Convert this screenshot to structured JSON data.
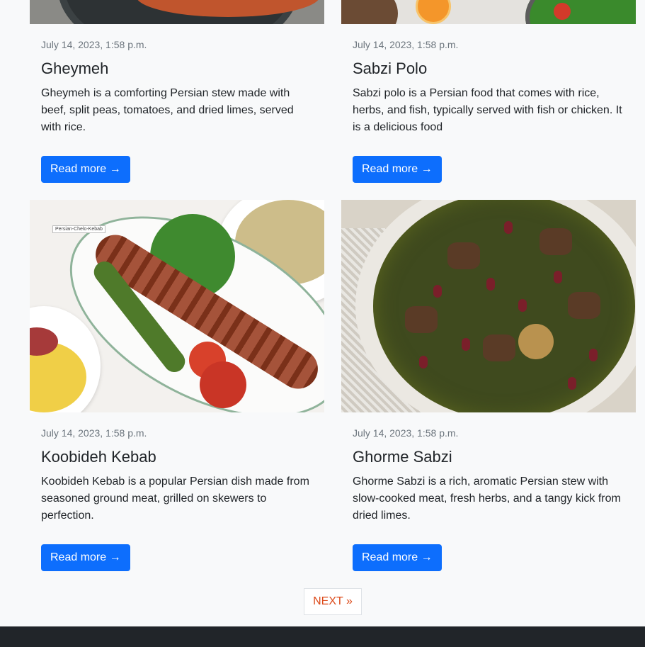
{
  "posts": [
    {
      "date": "July 14, 2023, 1:58 p.m.",
      "title": "Gheymeh",
      "description": "Gheymeh is a comforting Persian stew made with beef, split peas, tomatoes, and dried limes, served with rice.",
      "button": "Read more →"
    },
    {
      "date": "July 14, 2023, 1:58 p.m.",
      "title": "Sabzi Polo",
      "description": "Sabzi polo is a Persian food that comes with rice, herbs, and fish, typically served with fish or chicken. It is a delicious food",
      "button": "Read more →"
    },
    {
      "date": "July 14, 2023, 1:58 p.m.",
      "title": "Koobideh Kebab",
      "description": "Koobideh Kebab is a popular Persian dish made from seasoned ground meat, grilled on skewers to perfection.",
      "button": "Read more →",
      "image_caption": "Persian-Chelo-Kebab"
    },
    {
      "date": "July 14, 2023, 1:58 p.m.",
      "title": "Ghorme Sabzi",
      "description": "Ghorme Sabzi is a rich, aromatic Persian stew with slow-cooked meat, fresh herbs, and a tangy kick from dried limes.",
      "button": "Read more →"
    }
  ],
  "pagination": {
    "next_label": "NEXT »"
  },
  "colors": {
    "primary_button": "#0d6efd",
    "next_link": "#dc4a1a",
    "footer": "#212529",
    "page_background": "#f8f9fa"
  }
}
